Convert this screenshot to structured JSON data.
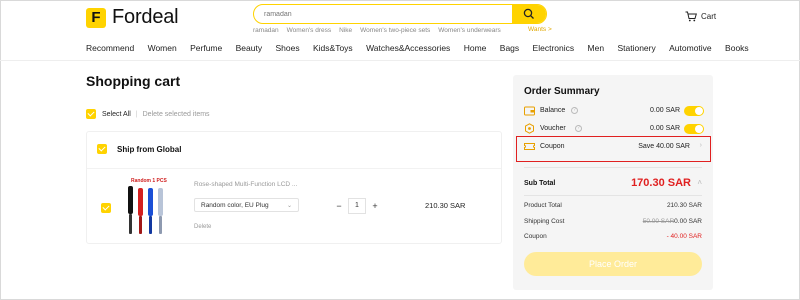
{
  "header": {
    "logo_letter": "F",
    "logo_text": "Fordeal",
    "search_placeholder": "ramadan",
    "suggestions": [
      "ramadan",
      "Women's dress",
      "Nike",
      "Women's two-piece sets",
      "Women's underwears"
    ],
    "wants": "Wants >",
    "cart_label": "Cart"
  },
  "categories": [
    "Recommend",
    "Women",
    "Perfume",
    "Beauty",
    "Shoes",
    "Kids&Toys",
    "Watches&Accessories",
    "Home",
    "Bags",
    "Electronics",
    "Men",
    "Stationery",
    "Automotive",
    "Books"
  ],
  "cart": {
    "title": "Shopping cart",
    "select_all": "Select All",
    "delete_selected": "Delete selected items",
    "ship_label": "Ship from Global",
    "item": {
      "promo": "Random 1 PCS",
      "name": "Rose-shaped Multi-Function LCD ...",
      "variant": "Random color, EU Plug",
      "delete": "Delete",
      "qty_minus": "−",
      "qty": "1",
      "qty_plus": "+",
      "price": "210.30 SAR",
      "colors": [
        "#111111",
        "#d42020",
        "#1a4fd6",
        "#b8c4d8"
      ]
    }
  },
  "summary": {
    "title": "Order Summary",
    "balance_label": "Balance",
    "balance_amount": "0.00 SAR",
    "voucher_label": "Voucher",
    "voucher_amount": "0.00 SAR",
    "coupon_label": "Coupon",
    "coupon_amount": "Save 40.00 SAR",
    "subtotal_label": "Sub Total",
    "subtotal_amount": "170.30 SAR",
    "product_total_label": "Product Total",
    "product_total_amount": "210.30 SAR",
    "shipping_label": "Shipping Cost",
    "shipping_old": "50.00 SAR",
    "shipping_new": "0.00 SAR",
    "coupon_discount_label": "Coupon",
    "coupon_discount_amount": "- 40.00 SAR",
    "place_order": "Place Order"
  },
  "colors": {
    "accent": "#ffd300",
    "price_red": "#e02020",
    "highlight_border": "#e02020"
  }
}
